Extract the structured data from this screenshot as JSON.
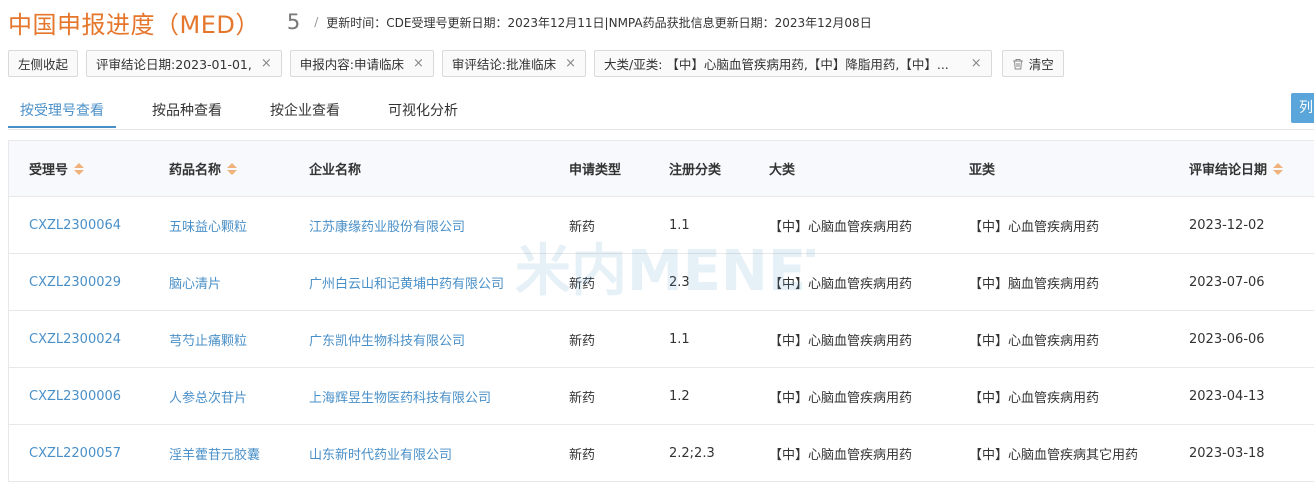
{
  "header": {
    "title": "中国申报进度（MED）",
    "count": "5",
    "separator": "/",
    "update_info": "更新时间：CDE受理号更新日期：2023年12月11日|NMPA药品获批信息更新日期：2023年12月08日"
  },
  "filters": [
    {
      "label": "左侧收起"
    },
    {
      "label": "评审结论日期:2023-01-01,",
      "close": "×"
    },
    {
      "label": "申报内容:申请临床",
      "close": "×"
    },
    {
      "label": "审评结论:批准临床",
      "close": "×"
    },
    {
      "label": "大类/亚类: 【中】心脑血管疾病用药,【中】降脂用药,【中】...",
      "close": "×"
    },
    {
      "label": "清空",
      "icon": "trash-icon"
    }
  ],
  "tabs": [
    {
      "label": "按受理号查看",
      "active": true
    },
    {
      "label": "按品种查看"
    },
    {
      "label": "按企业查看"
    },
    {
      "label": "可视化分析"
    }
  ],
  "corner_button": {
    "label": "列"
  },
  "watermark": {
    "text": "米内MENET"
  },
  "table": {
    "columns": [
      "受理号",
      "药品名称",
      "企业名称",
      "申请类型",
      "注册分类",
      "大类",
      "亚类",
      "评审结论日期"
    ],
    "rows": [
      [
        "CXZL2300064",
        "五味益心颗粒",
        "江苏康缘药业股份有限公司",
        "新药",
        "1.1",
        "【中】心脑血管疾病用药",
        "【中】心血管疾病用药",
        "2023-12-02"
      ],
      [
        "CXZL2300029",
        "脑心清片",
        "广州白云山和记黄埔中药有限公司",
        "新药",
        "2.3",
        "【中】心脑血管疾病用药",
        "【中】脑血管疾病用药",
        "2023-07-06"
      ],
      [
        "CXZL2300024",
        "芎芍止痛颗粒",
        "广东凯仲生物科技有限公司",
        "新药",
        "1.1",
        "【中】心脑血管疾病用药",
        "【中】心血管疾病用药",
        "2023-06-06"
      ],
      [
        "CXZL2300006",
        "人参总次苷片",
        "上海辉昱生物医药科技有限公司",
        "新药",
        "1.2",
        "【中】心脑血管疾病用药",
        "【中】心血管疾病用药",
        "2023-04-13"
      ],
      [
        "CXZL2200057",
        "淫羊藿苷元胶囊",
        "山东新时代药业有限公司",
        "新药",
        "2.2;2.3",
        "【中】心脑血管疾病用药",
        "【中】心脑血管疾病其它用药",
        "2023-03-18"
      ]
    ]
  },
  "colors": {
    "accent": "#e5762b",
    "link": "#4a90c8",
    "header_bg": "#f7f9fc"
  }
}
